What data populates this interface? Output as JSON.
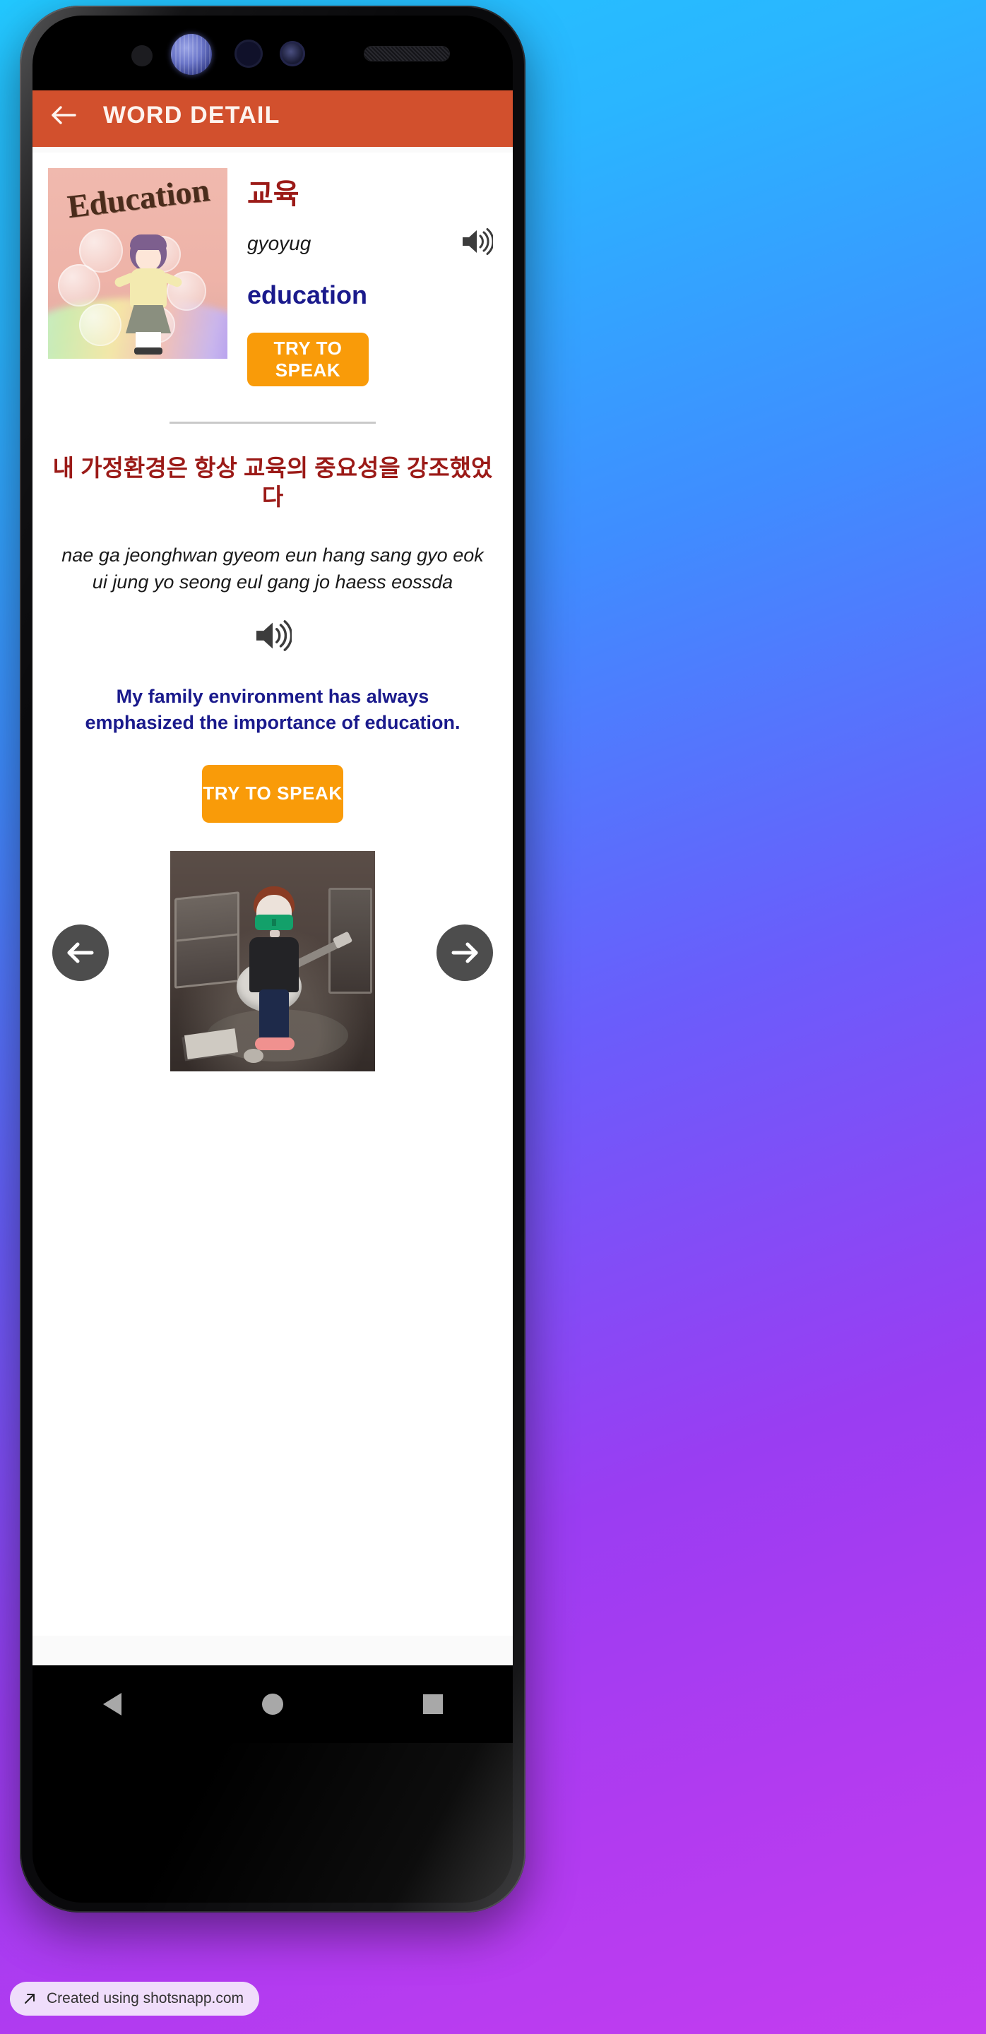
{
  "app": {
    "bar": {
      "title": "WORD DETAIL",
      "back_icon": "arrow-left-icon"
    },
    "accent_colors": {
      "app_bar": "#d2502d",
      "korean_text": "#9b1a17",
      "english_text": "#1a1a8c",
      "button_orange": "#f99b09",
      "nav_circle": "#4d4d4d"
    }
  },
  "word": {
    "image_caption": "Education",
    "korean": "교육",
    "romanization": "gyoyug",
    "english": "education",
    "audio_icon": "speaker-icon",
    "speak_button_label": "TRY TO SPEAK"
  },
  "sentence": {
    "korean": "내 가정환경은 항상 교육의 중요성을 강조했었다",
    "romanization": "nae ga jeonghwan gyeom eun hang sang gyo eok ui jung yo seong eul gang jo haess eossda",
    "english": "My family environment has always emphasized the importance of education.",
    "audio_icon": "speaker-icon",
    "speak_button_label": "TRY TO SPEAK"
  },
  "media": {
    "prev_icon": "arrow-left-circle-icon",
    "next_icon": "arrow-right-circle-icon",
    "illustration_alt": "claymation boy with green glasses playing acoustic guitar"
  },
  "android_nav": {
    "back": "back-triangle-icon",
    "home": "home-circle-icon",
    "recents": "recents-square-icon"
  },
  "watermark": {
    "icon": "arrow-up-right-icon",
    "text": "Created using shotsnapp.com"
  }
}
